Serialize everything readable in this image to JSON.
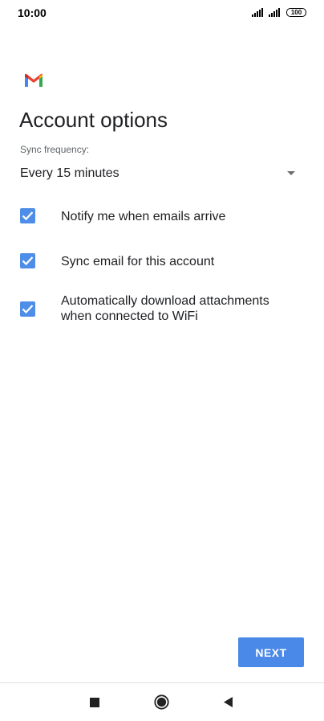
{
  "status_bar": {
    "time": "10:00",
    "battery": "100"
  },
  "header": {
    "logo_icon": "gmail-logo",
    "title": "Account options"
  },
  "sync": {
    "label": "Sync frequency:",
    "value": "Every 15 minutes"
  },
  "options": [
    {
      "label": "Notify me when emails arrive",
      "checked": true
    },
    {
      "label": "Sync email for this account",
      "checked": true
    },
    {
      "label": "Automatically download attachments when connected to WiFi",
      "checked": true
    }
  ],
  "footer": {
    "next_label": "NEXT"
  },
  "colors": {
    "accent": "#4a89e8",
    "checkbox": "#4f8ee8"
  }
}
